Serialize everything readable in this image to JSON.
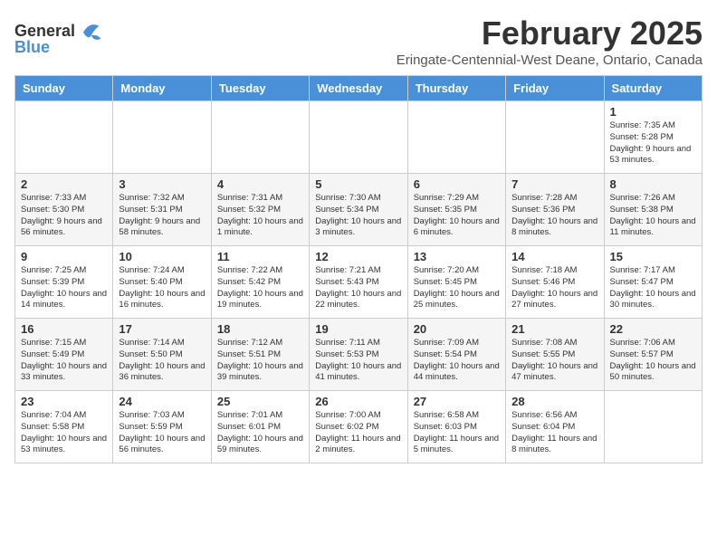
{
  "header": {
    "logo_general": "General",
    "logo_blue": "Blue",
    "title": "February 2025",
    "subtitle": "Eringate-Centennial-West Deane, Ontario, Canada"
  },
  "days_of_week": [
    "Sunday",
    "Monday",
    "Tuesday",
    "Wednesday",
    "Thursday",
    "Friday",
    "Saturday"
  ],
  "weeks": [
    [
      {
        "day": "",
        "info": ""
      },
      {
        "day": "",
        "info": ""
      },
      {
        "day": "",
        "info": ""
      },
      {
        "day": "",
        "info": ""
      },
      {
        "day": "",
        "info": ""
      },
      {
        "day": "",
        "info": ""
      },
      {
        "day": "1",
        "info": "Sunrise: 7:35 AM\nSunset: 5:28 PM\nDaylight: 9 hours and 53 minutes."
      }
    ],
    [
      {
        "day": "2",
        "info": "Sunrise: 7:33 AM\nSunset: 5:30 PM\nDaylight: 9 hours and 56 minutes."
      },
      {
        "day": "3",
        "info": "Sunrise: 7:32 AM\nSunset: 5:31 PM\nDaylight: 9 hours and 58 minutes."
      },
      {
        "day": "4",
        "info": "Sunrise: 7:31 AM\nSunset: 5:32 PM\nDaylight: 10 hours and 1 minute."
      },
      {
        "day": "5",
        "info": "Sunrise: 7:30 AM\nSunset: 5:34 PM\nDaylight: 10 hours and 3 minutes."
      },
      {
        "day": "6",
        "info": "Sunrise: 7:29 AM\nSunset: 5:35 PM\nDaylight: 10 hours and 6 minutes."
      },
      {
        "day": "7",
        "info": "Sunrise: 7:28 AM\nSunset: 5:36 PM\nDaylight: 10 hours and 8 minutes."
      },
      {
        "day": "8",
        "info": "Sunrise: 7:26 AM\nSunset: 5:38 PM\nDaylight: 10 hours and 11 minutes."
      }
    ],
    [
      {
        "day": "9",
        "info": "Sunrise: 7:25 AM\nSunset: 5:39 PM\nDaylight: 10 hours and 14 minutes."
      },
      {
        "day": "10",
        "info": "Sunrise: 7:24 AM\nSunset: 5:40 PM\nDaylight: 10 hours and 16 minutes."
      },
      {
        "day": "11",
        "info": "Sunrise: 7:22 AM\nSunset: 5:42 PM\nDaylight: 10 hours and 19 minutes."
      },
      {
        "day": "12",
        "info": "Sunrise: 7:21 AM\nSunset: 5:43 PM\nDaylight: 10 hours and 22 minutes."
      },
      {
        "day": "13",
        "info": "Sunrise: 7:20 AM\nSunset: 5:45 PM\nDaylight: 10 hours and 25 minutes."
      },
      {
        "day": "14",
        "info": "Sunrise: 7:18 AM\nSunset: 5:46 PM\nDaylight: 10 hours and 27 minutes."
      },
      {
        "day": "15",
        "info": "Sunrise: 7:17 AM\nSunset: 5:47 PM\nDaylight: 10 hours and 30 minutes."
      }
    ],
    [
      {
        "day": "16",
        "info": "Sunrise: 7:15 AM\nSunset: 5:49 PM\nDaylight: 10 hours and 33 minutes."
      },
      {
        "day": "17",
        "info": "Sunrise: 7:14 AM\nSunset: 5:50 PM\nDaylight: 10 hours and 36 minutes."
      },
      {
        "day": "18",
        "info": "Sunrise: 7:12 AM\nSunset: 5:51 PM\nDaylight: 10 hours and 39 minutes."
      },
      {
        "day": "19",
        "info": "Sunrise: 7:11 AM\nSunset: 5:53 PM\nDaylight: 10 hours and 41 minutes."
      },
      {
        "day": "20",
        "info": "Sunrise: 7:09 AM\nSunset: 5:54 PM\nDaylight: 10 hours and 44 minutes."
      },
      {
        "day": "21",
        "info": "Sunrise: 7:08 AM\nSunset: 5:55 PM\nDaylight: 10 hours and 47 minutes."
      },
      {
        "day": "22",
        "info": "Sunrise: 7:06 AM\nSunset: 5:57 PM\nDaylight: 10 hours and 50 minutes."
      }
    ],
    [
      {
        "day": "23",
        "info": "Sunrise: 7:04 AM\nSunset: 5:58 PM\nDaylight: 10 hours and 53 minutes."
      },
      {
        "day": "24",
        "info": "Sunrise: 7:03 AM\nSunset: 5:59 PM\nDaylight: 10 hours and 56 minutes."
      },
      {
        "day": "25",
        "info": "Sunrise: 7:01 AM\nSunset: 6:01 PM\nDaylight: 10 hours and 59 minutes."
      },
      {
        "day": "26",
        "info": "Sunrise: 7:00 AM\nSunset: 6:02 PM\nDaylight: 11 hours and 2 minutes."
      },
      {
        "day": "27",
        "info": "Sunrise: 6:58 AM\nSunset: 6:03 PM\nDaylight: 11 hours and 5 minutes."
      },
      {
        "day": "28",
        "info": "Sunrise: 6:56 AM\nSunset: 6:04 PM\nDaylight: 11 hours and 8 minutes."
      },
      {
        "day": "",
        "info": ""
      }
    ]
  ]
}
